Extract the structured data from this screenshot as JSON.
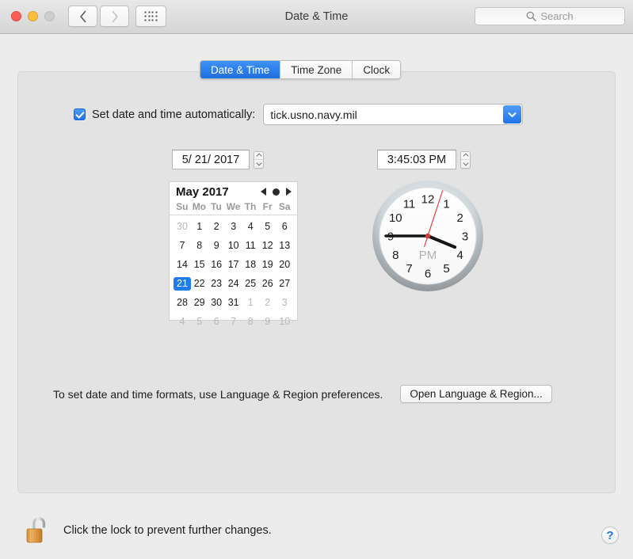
{
  "window": {
    "title": "Date & Time",
    "traffic_lights": [
      "close",
      "minimize",
      "zoom"
    ],
    "nav_back_icon": "chevron-left-icon",
    "nav_forward_icon": "chevron-right-icon",
    "show_all_icon": "grid-icon"
  },
  "search": {
    "placeholder": "Search",
    "value": "",
    "icon": "search-icon"
  },
  "tabs": [
    {
      "label": "Date & Time",
      "selected": true
    },
    {
      "label": "Time Zone",
      "selected": false
    },
    {
      "label": "Clock",
      "selected": false
    }
  ],
  "auto_row": {
    "checkbox_checked": true,
    "label": "Set date and time automatically:",
    "server_value": "tick.usno.navy.mil",
    "dropdown_icon": "chevron-down-icon"
  },
  "date_field": {
    "value": "5/ 21/ 2017",
    "stepper_icon": "stepper-up-down-icon"
  },
  "time_field": {
    "value": "3:45:03 PM",
    "stepper_icon": "stepper-up-down-icon"
  },
  "calendar": {
    "month_label": "May 2017",
    "prev_icon": "triangle-left-icon",
    "today_icon": "dot-icon",
    "next_icon": "triangle-right-icon",
    "day_headers": [
      "Su",
      "Mo",
      "Tu",
      "We",
      "Th",
      "Fr",
      "Sa"
    ],
    "selected_day": 21,
    "weeks": [
      [
        {
          "d": "30",
          "muted": true
        },
        {
          "d": "1"
        },
        {
          "d": "2"
        },
        {
          "d": "3"
        },
        {
          "d": "4"
        },
        {
          "d": "5"
        },
        {
          "d": "6"
        }
      ],
      [
        {
          "d": "7"
        },
        {
          "d": "8"
        },
        {
          "d": "9"
        },
        {
          "d": "10"
        },
        {
          "d": "11"
        },
        {
          "d": "12"
        },
        {
          "d": "13"
        }
      ],
      [
        {
          "d": "14"
        },
        {
          "d": "15"
        },
        {
          "d": "16"
        },
        {
          "d": "17"
        },
        {
          "d": "18"
        },
        {
          "d": "19"
        },
        {
          "d": "20"
        }
      ],
      [
        {
          "d": "21",
          "selected": true
        },
        {
          "d": "22"
        },
        {
          "d": "23"
        },
        {
          "d": "24"
        },
        {
          "d": "25"
        },
        {
          "d": "26"
        },
        {
          "d": "27"
        }
      ],
      [
        {
          "d": "28"
        },
        {
          "d": "29"
        },
        {
          "d": "30"
        },
        {
          "d": "31"
        },
        {
          "d": "1",
          "muted": true
        },
        {
          "d": "2",
          "muted": true
        },
        {
          "d": "3",
          "muted": true
        }
      ],
      [
        {
          "d": "4",
          "muted": true
        },
        {
          "d": "5",
          "muted": true
        },
        {
          "d": "6",
          "muted": true
        },
        {
          "d": "7",
          "muted": true
        },
        {
          "d": "8",
          "muted": true
        },
        {
          "d": "9",
          "muted": true
        },
        {
          "d": "10",
          "muted": true
        }
      ]
    ]
  },
  "clock": {
    "hour_numerals": [
      "12",
      "1",
      "2",
      "3",
      "4",
      "5",
      "6",
      "7",
      "8",
      "9",
      "10",
      "11"
    ],
    "meridiem_label": "PM",
    "hour": 3,
    "minute": 45,
    "second": 3,
    "hour_hand_angle": 112.5,
    "minute_hand_angle": 270,
    "second_hand_angle": 18,
    "second_hand_color": "#e8403a",
    "face_color": "#ffffff",
    "bezel_color": "#9ea3a7"
  },
  "formats": {
    "text": "To set date and time formats, use Language & Region preferences.",
    "button_label": "Open Language & Region..."
  },
  "lock": {
    "icon": "unlocked-padlock-icon",
    "text": "Click the lock to prevent further changes."
  },
  "help": {
    "label": "?",
    "icon": "question-mark-icon"
  },
  "colors": {
    "accent_blue": "#1f7ced",
    "window_bg": "#ececec",
    "panel_bg": "#e3e3e3",
    "lock_gold": "#e0932f"
  }
}
